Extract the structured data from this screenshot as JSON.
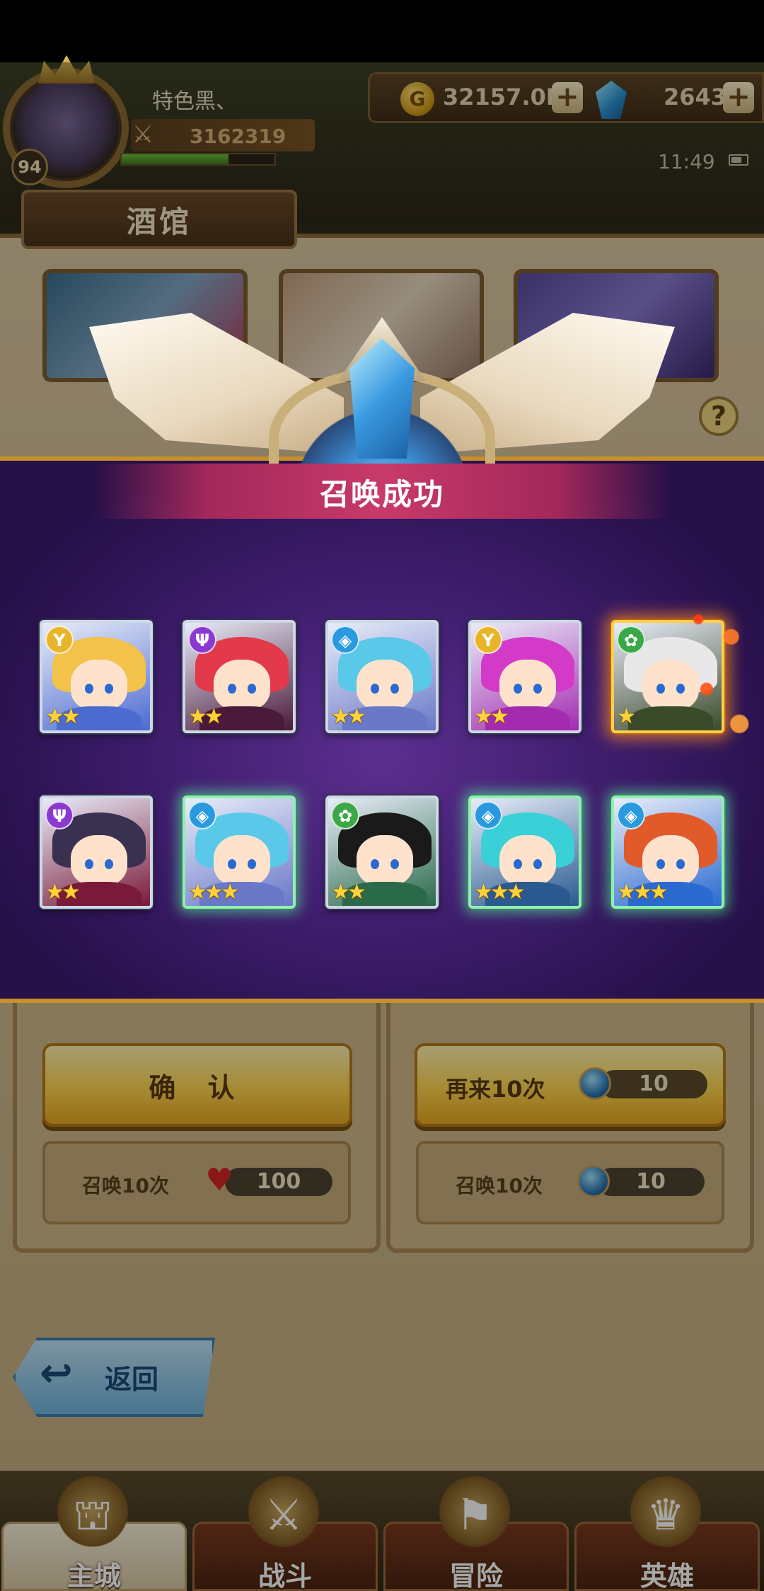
{
  "player": {
    "name": "特色黑、",
    "level": "94",
    "power": "3162319",
    "exp_fraction": 0.7
  },
  "resources": {
    "gold": "32157.0K",
    "gems": "2643"
  },
  "status": {
    "time": "11:49"
  },
  "page": {
    "title": "酒馆"
  },
  "modal": {
    "title": "召唤成功",
    "heroes": [
      {
        "faction": "light",
        "faction_glyph": "Y",
        "faction_color": "#e8b52a",
        "stars": 2,
        "hair": "#f2c24a",
        "body": "#4c6bd0",
        "frame": "normal"
      },
      {
        "faction": "dark",
        "faction_glyph": "Ψ",
        "faction_color": "#8a3ad0",
        "stars": 2,
        "hair": "#e23a4a",
        "body": "#4a1a3a",
        "frame": "normal"
      },
      {
        "faction": "water",
        "faction_glyph": "◈",
        "faction_color": "#2a9ae0",
        "stars": 2,
        "hair": "#5ac8e8",
        "body": "#6a78c8",
        "frame": "normal"
      },
      {
        "faction": "light",
        "faction_glyph": "Y",
        "faction_color": "#e8b52a",
        "stars": 2,
        "hair": "#d43ac8",
        "body": "#a42ab0",
        "frame": "normal"
      },
      {
        "faction": "nature",
        "faction_glyph": "✿",
        "faction_color": "#3aa848",
        "stars": 1,
        "hair": "#e8e8e8",
        "body": "#3a4a2a",
        "frame": "gold"
      },
      {
        "faction": "dark",
        "faction_glyph": "Ψ",
        "faction_color": "#8a3ad0",
        "stars": 2,
        "hair": "#3a3050",
        "body": "#7a1a3a",
        "frame": "normal"
      },
      {
        "faction": "water",
        "faction_glyph": "◈",
        "faction_color": "#2a9ae0",
        "stars": 3,
        "hair": "#5ac8e8",
        "body": "#6a78c8",
        "frame": "glow"
      },
      {
        "faction": "nature",
        "faction_glyph": "✿",
        "faction_color": "#3aa848",
        "stars": 2,
        "hair": "#1a1a1a",
        "body": "#2a6a4a",
        "frame": "normal"
      },
      {
        "faction": "water",
        "faction_glyph": "◈",
        "faction_color": "#2a9ae0",
        "stars": 3,
        "hair": "#3ad0d8",
        "body": "#2a5a90",
        "frame": "glow"
      },
      {
        "faction": "water",
        "faction_glyph": "◈",
        "faction_color": "#2a9ae0",
        "stars": 3,
        "hair": "#e05a2a",
        "body": "#2a6ad0",
        "frame": "glow"
      }
    ]
  },
  "actions": {
    "confirm_label": "确 认",
    "again_label": "再来10次",
    "again_cost": "10"
  },
  "summon_rows": {
    "left": {
      "label": "召唤10次",
      "cost": "100"
    },
    "right": {
      "label": "召唤10次",
      "cost": "10"
    }
  },
  "back": {
    "label": "返回"
  },
  "nav": {
    "items": [
      {
        "label": "主城",
        "icon": "castle-icon"
      },
      {
        "label": "战斗",
        "icon": "crossed-swords-icon"
      },
      {
        "label": "冒险",
        "icon": "adventure-icon"
      },
      {
        "label": "英雄",
        "icon": "hero-icon"
      }
    ]
  }
}
